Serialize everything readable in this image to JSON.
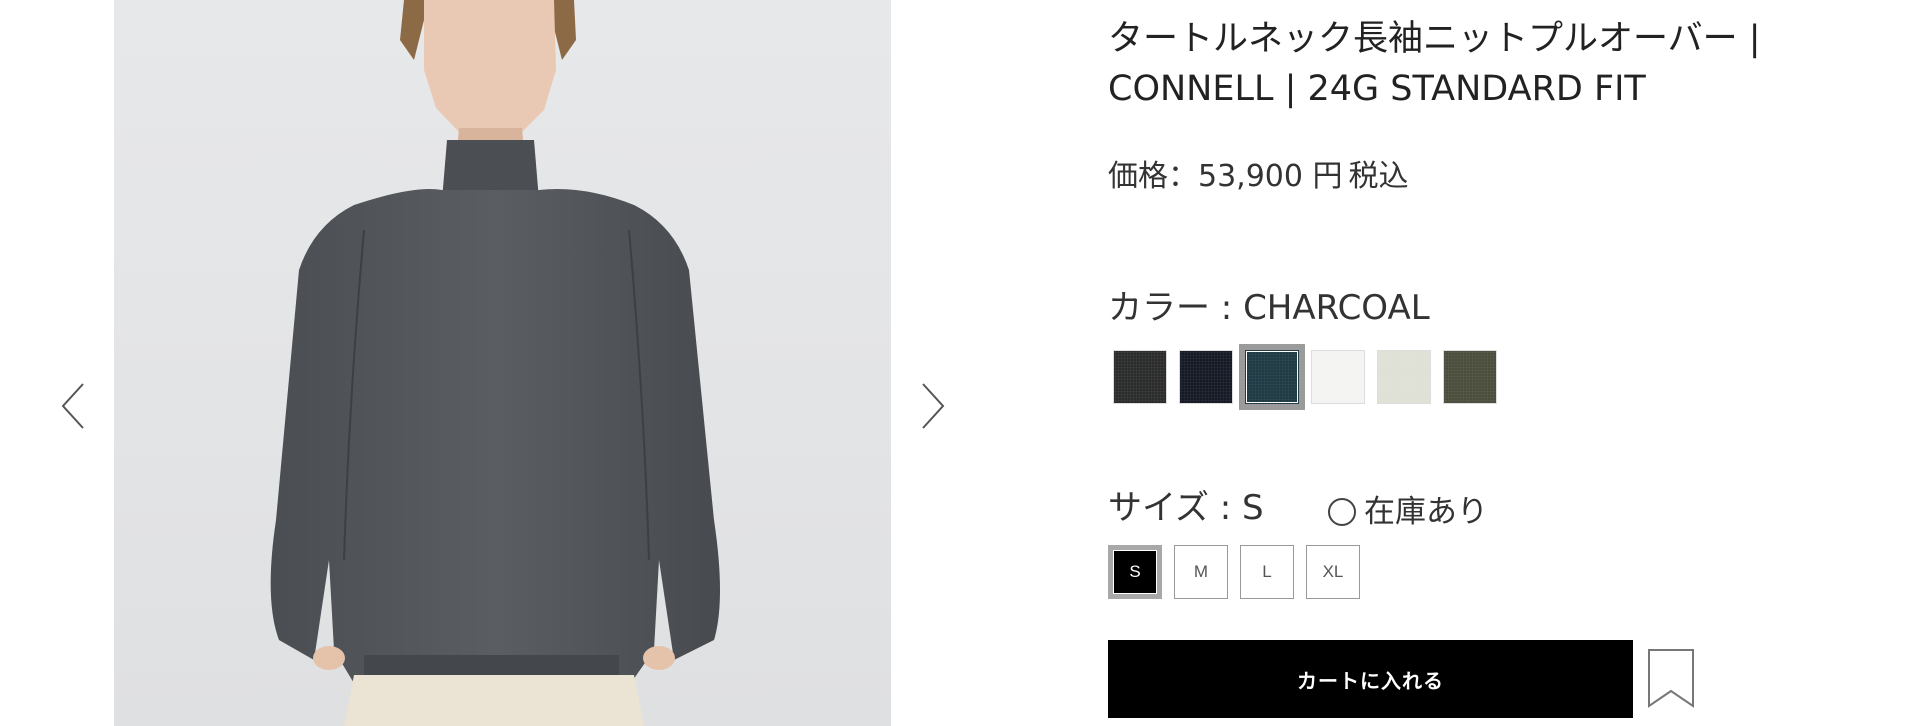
{
  "gallery": {
    "prev_icon": "chevron-left-icon",
    "next_icon": "chevron-right-icon",
    "image_alt": "Model wearing charcoal turtleneck knit pullover"
  },
  "product": {
    "title_line1": "タートルネック長袖ニットプルオーバー |",
    "title_line2": "CONNELL | 24G STANDARD FIT",
    "price_label": "価格：53,900 円",
    "price_tax": "税込"
  },
  "color": {
    "label": "カラー : CHARCOAL",
    "selected": "CHARCOAL",
    "swatches": [
      {
        "hex": "#2b2c2c",
        "selected": false
      },
      {
        "hex": "#161a26",
        "selected": false
      },
      {
        "hex": "#1f3a44",
        "selected": true
      },
      {
        "hex": "#f3f3f1",
        "selected": false
      },
      {
        "hex": "#dfe1d6",
        "selected": false
      },
      {
        "hex": "#4b4d3d",
        "selected": false
      }
    ]
  },
  "size": {
    "label": "サイズ : S",
    "stock_text": "在庫あり",
    "stock_icon": "circle-icon",
    "options": [
      "S",
      "M",
      "L",
      "XL"
    ],
    "selected": "S"
  },
  "actions": {
    "cart_label": "カートに入れる",
    "bookmark_icon": "bookmark-icon"
  },
  "colors": {
    "primary_button": "#000000",
    "selected_border": "#9b9b9b",
    "text": "#222222"
  }
}
